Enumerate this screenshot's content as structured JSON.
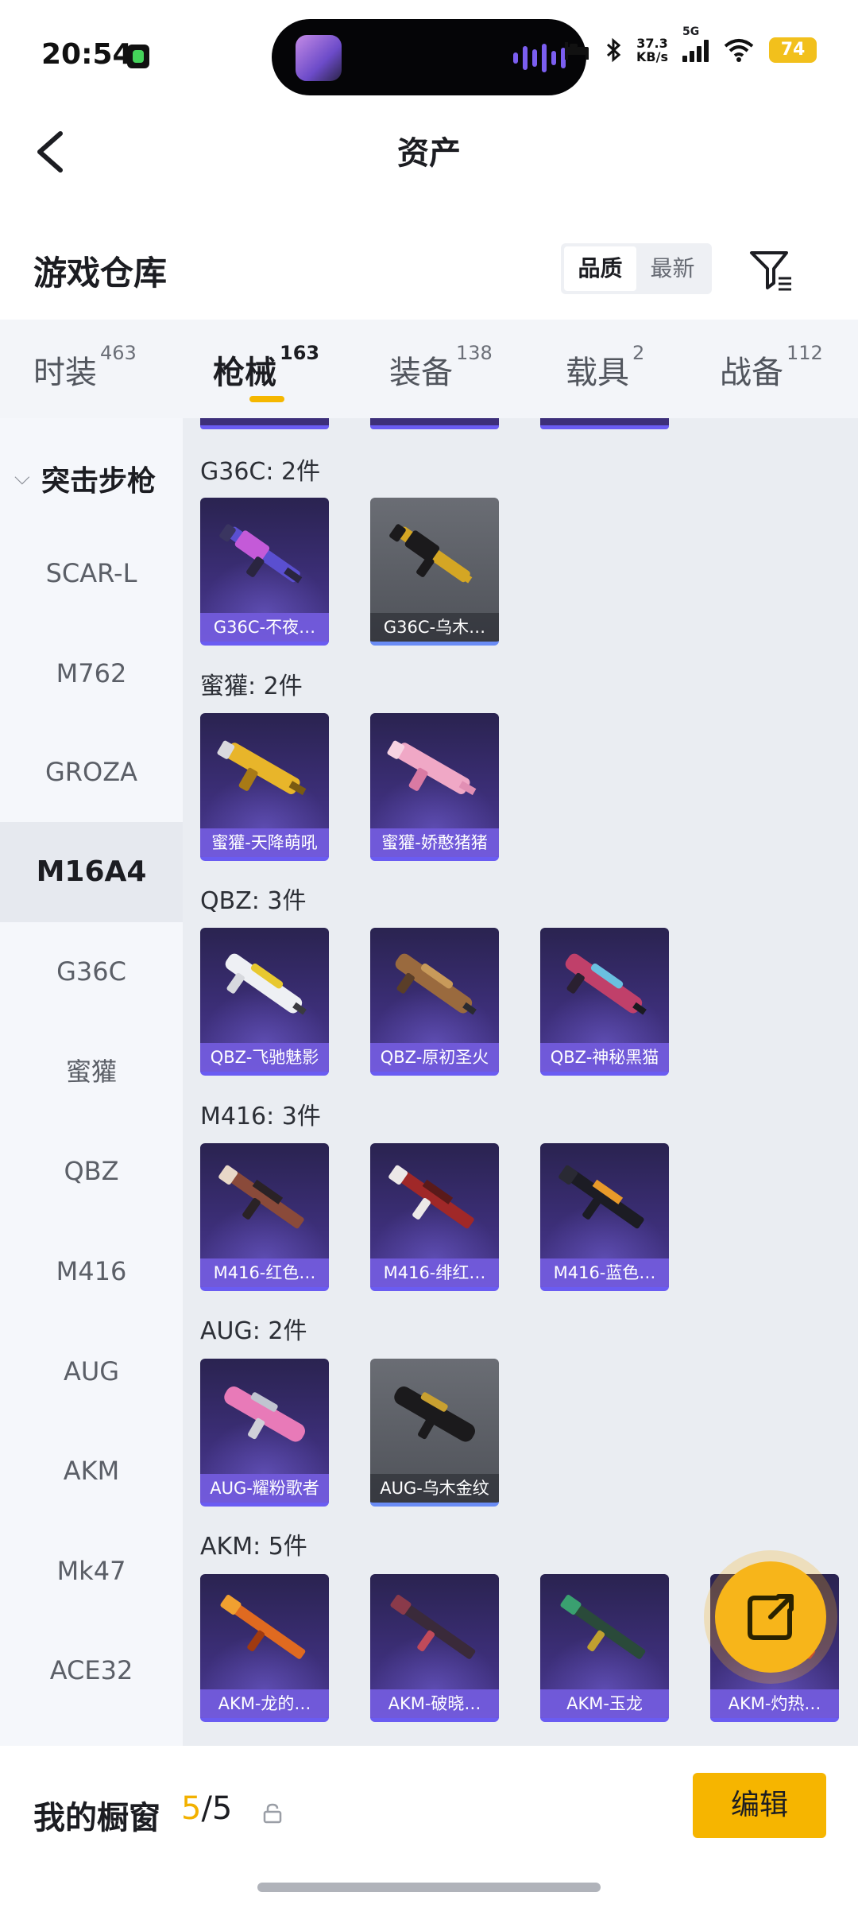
{
  "status_bar": {
    "time": "20:54",
    "network_speed_value": "37.3",
    "network_speed_unit": "KB/s",
    "network_type": "5G",
    "battery": "74"
  },
  "header": {
    "title": "资产"
  },
  "section": {
    "title": "游戏仓库",
    "sort_options": [
      "品质",
      "最新"
    ],
    "sort_selected": "品质"
  },
  "tabs": [
    {
      "label": "时装",
      "count": "463"
    },
    {
      "label": "枪械",
      "count": "163",
      "active": true
    },
    {
      "label": "装备",
      "count": "138"
    },
    {
      "label": "载具",
      "count": "2"
    },
    {
      "label": "战备",
      "count": "112"
    }
  ],
  "sidebar": {
    "group": "突击步枪",
    "items": [
      "SCAR-L",
      "M762",
      "GROZA",
      "M16A4",
      "G36C",
      "蜜獾",
      "QBZ",
      "M416",
      "AUG",
      "AKM",
      "Mk47",
      "ACE32"
    ],
    "selected": "M16A4"
  },
  "groups": [
    {
      "title": "G36C: 2件",
      "items": [
        {
          "name": "G36C-不夜…",
          "grey": false
        },
        {
          "name": "G36C-乌木…",
          "grey": true
        }
      ]
    },
    {
      "title": "蜜獾: 2件",
      "items": [
        {
          "name": "蜜獾-天降萌吼",
          "grey": false
        },
        {
          "name": "蜜獾-娇憨猪猪",
          "grey": false
        }
      ]
    },
    {
      "title": "QBZ: 3件",
      "items": [
        {
          "name": "QBZ-飞驰魅影",
          "grey": false
        },
        {
          "name": "QBZ-原初圣火",
          "grey": false
        },
        {
          "name": "QBZ-神秘黑猫",
          "grey": false
        }
      ]
    },
    {
      "title": "M416: 3件",
      "items": [
        {
          "name": "M416-红色…",
          "grey": false
        },
        {
          "name": "M416-绯红…",
          "grey": false
        },
        {
          "name": "M416-蓝色…",
          "grey": false
        }
      ]
    },
    {
      "title": "AUG: 2件",
      "items": [
        {
          "name": "AUG-耀粉歌者",
          "grey": false
        },
        {
          "name": "AUG-乌木金纹",
          "grey": true
        }
      ]
    },
    {
      "title": "AKM: 5件",
      "items": [
        {
          "name": "AKM-龙的…",
          "grey": false
        },
        {
          "name": "AKM-破晓…",
          "grey": false
        },
        {
          "name": "AKM-玉龙",
          "grey": false
        },
        {
          "name": "AKM-灼热…",
          "grey": false
        }
      ]
    }
  ],
  "bottom_bar": {
    "window_label": "我的橱窗",
    "window_used": "5",
    "window_total": "/5",
    "edit_label": "编辑"
  },
  "icons": {
    "back": "chevron-left-icon",
    "filter": "filter-icon",
    "lock": "lock-icon",
    "fab": "share-out-icon"
  },
  "colors": {
    "accent": "#f6b500",
    "card_purple": "#3d2f7a",
    "card_border": "#6a5cf2"
  }
}
